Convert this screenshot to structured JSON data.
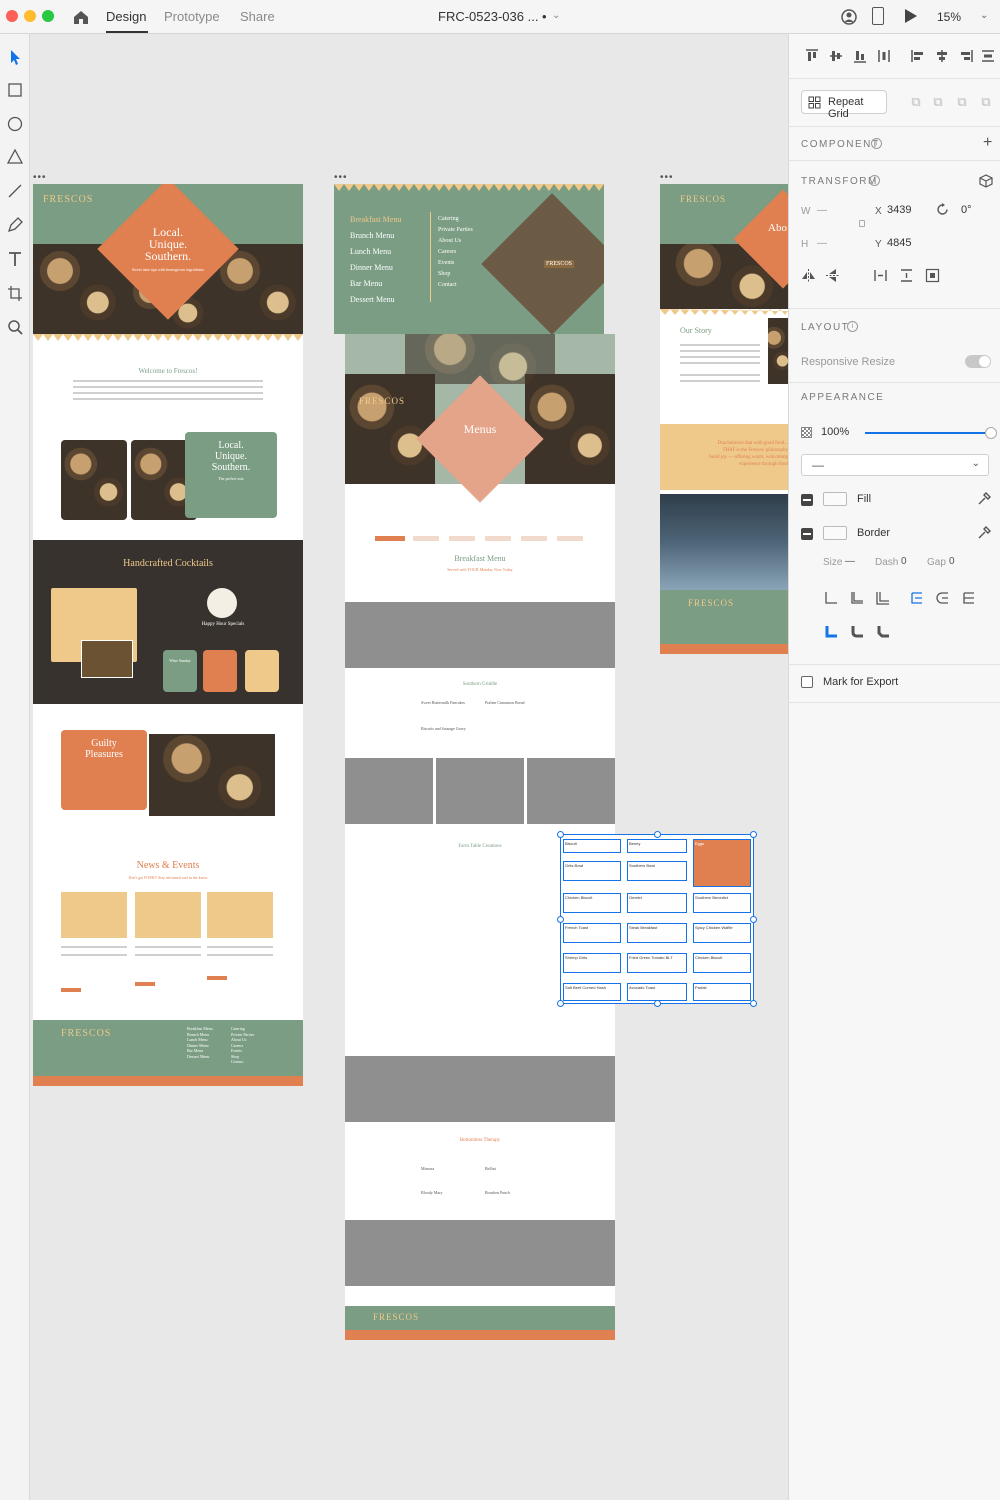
{
  "topbar": {
    "tabs": [
      {
        "label": "Design"
      },
      {
        "label": "Prototype"
      },
      {
        "label": "Share"
      }
    ],
    "document_title": "FRC-0523-036 ... •",
    "zoom": "15%"
  },
  "canvas": {
    "artboard_home": {
      "logo": "FRESCOS",
      "hero_text": "Local.\nUnique.\nSouthern.",
      "hero_sub": "Sweet time sips with homegrown ingredients",
      "welcome_title": "Welcome to Frescos!",
      "promo_title": "Local.\nUnique.\nSouthern.",
      "promo_sub": "The perfect mix",
      "cocktails_title": "Handcrafted Cocktails",
      "happy_hour": "Happy Hour Specials",
      "badge_wine": "Wine Sunday",
      "guilty_title": "Guilty\nPleasures",
      "news_title": "News & Events",
      "news_sub": "Don't get FOMO! Stay informed and in the know",
      "footer_logo": "FRESCOS",
      "footer_links_col1": [
        "Breakfast Menu",
        "Brunch Menu",
        "Lunch Menu",
        "Dinner Menu",
        "Bar Menu",
        "Dessert Menu"
      ],
      "footer_links_col2": [
        "Catering",
        "Private Parties",
        "About Us",
        "Careers",
        "Events",
        "Shop",
        "Contact"
      ]
    },
    "artboard_menu": {
      "nav_col1": [
        "Breakfast Menu",
        "Brunch Menu",
        "Lunch Menu",
        "Dinner Menu",
        "Bar Menu",
        "Dessert Menu"
      ],
      "nav_col2": [
        "Catering",
        "Private Parties",
        "About Us",
        "Careers",
        "Events",
        "Shop",
        "Contact"
      ],
      "logo": "FRESCOS",
      "hero_text": "Menus",
      "section_title": "Breakfast Menu",
      "section_sub": "Served with YOUR Monday Now Today",
      "southern_griddle": "Southern Griddle",
      "farm_table": "Farm Table Creations",
      "bottomless": "Bottomless Therapy",
      "griddle_items": [
        "Sweet Buttermilk Pancakes",
        "Praline Cinnamon Bread",
        "Biscuits and Sausage Gravy"
      ],
      "bottomless_items": [
        "Mimosa",
        "Bellini",
        "Bloody Mary",
        "Bourbon Punch"
      ],
      "repeat_grid_items": [
        "Biscuit",
        "Benny",
        "Eggs",
        "Grits Bowl",
        "Southern Bowl",
        "Chicken Biscuit",
        "Omelet",
        "Southern Benedict",
        "French Toast",
        "Steak Breakfast",
        "Spicy Chicken Waffle",
        "Shrimp Grits",
        "Fried Green Tomato BLT",
        "Chicken Biscuit",
        "Salt Beef Corned Hash",
        "Avocado Toast",
        "Parfait"
      ],
      "footer_logo": "FRESCOS"
    },
    "artboard_about": {
      "logo": "FRESCOS",
      "hero_text": "Abo",
      "story_title": "Our Story",
      "quote": "Dua believes that with good food...\nTHAT is the Frescos' philosophy\nbuild joy — offering warm, welcoming\nexperience through food",
      "footer_logo": "FRESCOS"
    }
  },
  "panel": {
    "repeat_grid": "Repeat Grid",
    "component": "COMPONENT",
    "transform": "TRANSFORM",
    "w_label": "W",
    "h_label": "H",
    "x_label": "X",
    "y_label": "Y",
    "w_value": "—",
    "h_value": "—",
    "x_value": "3439",
    "y_value": "4845",
    "rotation": "0°",
    "layout": "LAYOUT",
    "responsive_resize": "Responsive Resize",
    "appearance": "APPEARANCE",
    "opacity": "100%",
    "opacity_level": 1.0,
    "blend_value": "—",
    "fill": "Fill",
    "border": "Border",
    "size_label": "Size",
    "size_value": "—",
    "dash_label": "Dash",
    "dash_value": "0",
    "gap_label": "Gap",
    "gap_value": "0",
    "mark_for_export": "Mark for Export"
  },
  "colors": {
    "accent": "#1473e6",
    "brand_green": "#7a9d84",
    "brand_orange": "#e07f4f",
    "brand_sand": "#efc98a"
  }
}
